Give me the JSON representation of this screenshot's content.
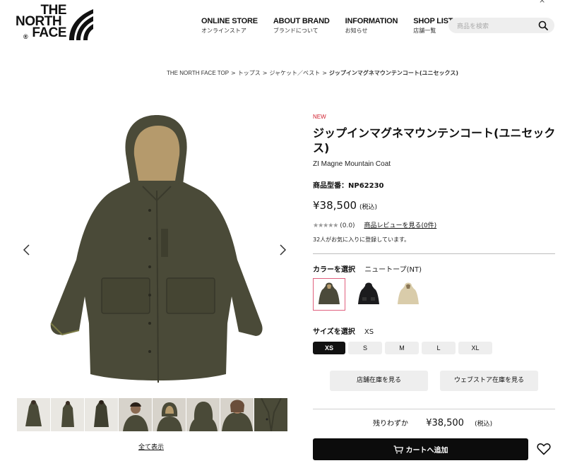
{
  "header": {
    "logo_lines": [
      "THE",
      "NORTH",
      "FACE"
    ],
    "logo_mark": "®",
    "nav": [
      {
        "en": "ONLINE STORE",
        "ja": "オンラインストア"
      },
      {
        "en": "ABOUT BRAND",
        "ja": "ブランドについて"
      },
      {
        "en": "INFORMATION",
        "ja": "お知らせ"
      },
      {
        "en": "SHOP LIST",
        "ja": "店舗一覧"
      }
    ],
    "search_placeholder": "商品を検索",
    "close_glyph": "×"
  },
  "breadcrumb": {
    "items": [
      "THE NORTH FACE TOP",
      "トップス",
      "ジャケット／ベスト"
    ],
    "separator": ">",
    "current": "ジップインマグネマウンテンコート(ユニセックス)"
  },
  "gallery": {
    "view_all": "全て表示",
    "thumbnail_count": 8
  },
  "product": {
    "badge": "NEW",
    "badge_color": "#d1202f",
    "title": "ジップインマグネマウンテンコート(ユニセックス)",
    "subtitle": "ZI Magne Mountain Coat",
    "code": "商品型番：NP62230",
    "price": "¥38,500",
    "tax_note": "(税込)",
    "stars": "★★★★★",
    "rating": "(0.0)",
    "review_link": "商品レビューを見る(0件)",
    "favorites": "32人がお気に入りに登録しています。",
    "color_label": "カラーを選択",
    "color_selected": "ニュートープ(NT)",
    "colors": [
      {
        "name": "olive",
        "hex": "#4b4a3a",
        "selected": true
      },
      {
        "name": "black",
        "hex": "#1b1b1d",
        "selected": false
      },
      {
        "name": "beige",
        "hex": "#d9ccaa",
        "selected": false
      }
    ],
    "size_label": "サイズを選択",
    "size_selected": "XS",
    "sizes": [
      "XS",
      "S",
      "M",
      "L",
      "XL"
    ],
    "store_stock_button": "店舗在庫を見る",
    "web_stock_button": "ウェブストア在庫を見る",
    "availability": "残りわずか",
    "availability_price": "¥38,500",
    "availability_tax": "(税込)",
    "cart_button": "カートへ追加"
  }
}
